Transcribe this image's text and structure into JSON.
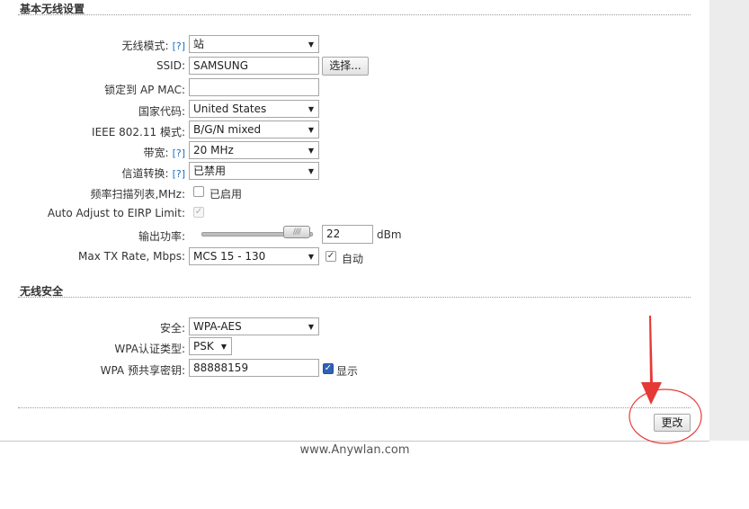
{
  "basic_wireless": {
    "title": "基本无线设置",
    "help": "[?]",
    "wireless_mode": {
      "label": "无线模式:",
      "value": "站"
    },
    "ssid": {
      "label": "SSID:",
      "value": "SAMSUNG",
      "select_button": "选择..."
    },
    "lock_ap_mac": {
      "label": "锁定到 AP MAC:",
      "value": ""
    },
    "country_code": {
      "label": "国家代码:",
      "value": "United States"
    },
    "ieee_mode": {
      "label": "IEEE 802.11 模式:",
      "value": "B/G/N mixed"
    },
    "bandwidth": {
      "label": "带宽:",
      "value": "20 MHz"
    },
    "channel_shifting": {
      "label": "信道转换:",
      "value": "已禁用"
    },
    "frequency_scan_list": {
      "label": "频率扫描列表,MHz:",
      "checkbox_label": "已启用",
      "checked": false
    },
    "auto_adjust_eirp": {
      "label": "Auto Adjust to EIRP Limit:",
      "checked": true,
      "disabled": true
    },
    "output_power": {
      "label": "输出功率:",
      "value": "22",
      "unit": "dBm",
      "slider_glyph": "////"
    },
    "max_tx_rate": {
      "label": "Max TX Rate, Mbps:",
      "value": "MCS 15 - 130",
      "auto_label": "自动",
      "auto_checked": true
    }
  },
  "wireless_security": {
    "title": "无线安全",
    "security": {
      "label": "安全:",
      "value": "WPA-AES"
    },
    "wpa_auth_type": {
      "label": "WPA认证类型:",
      "value": "PSK"
    },
    "wpa_psk": {
      "label": "WPA 预共享密钥:",
      "value": "88888159",
      "show_label": "显示",
      "show_checked": true
    }
  },
  "actions": {
    "change_button": "更改"
  },
  "footer": {
    "text": "www.Anywlan.com"
  },
  "colors": {
    "help_link": "#1a6fc0",
    "annotation": "#e53935",
    "checkbox_checked": "#2d62b6"
  }
}
